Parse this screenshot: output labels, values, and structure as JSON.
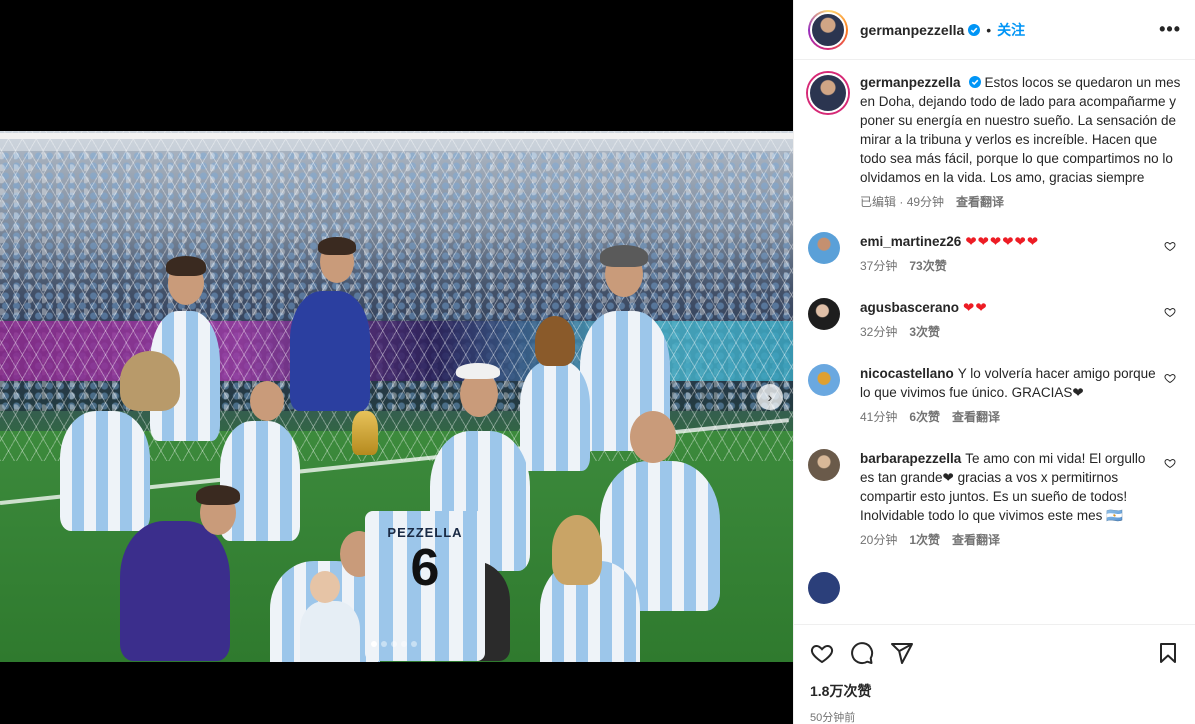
{
  "post": {
    "username": "germanpezzella",
    "separator": "•",
    "follow_label": "关注",
    "more_label": "•••"
  },
  "photo": {
    "jersey_name": "PEZZELLA",
    "jersey_number": "6",
    "slide_count": 5,
    "active_slide": 1
  },
  "caption": {
    "username": "germanpezzella",
    "text": "Estos locos se quedaron un mes en Doha, dejando todo de lado para acompañarme y poner su energía en nuestro sueño. La sensación de mirar a la tribuna y verlos es increíble. Hacen que todo sea más fácil, porque lo que compartimos no lo olvidamos en la vida. Los amo, gracias siempre",
    "edited": "已编辑",
    "time": "49分钟",
    "translate": "查看翻译"
  },
  "comments": [
    {
      "username": "emi_martinez26",
      "text": "❤❤❤❤❤❤",
      "time": "37分钟",
      "likes": "73次赞",
      "translate": ""
    },
    {
      "username": "agusbascerano",
      "text": "❤❤",
      "time": "32分钟",
      "likes": "3次赞",
      "translate": ""
    },
    {
      "username": "nicocastellano",
      "text": "Y lo volvería hacer amigo porque lo que vivimos fue único. GRACIAS❤",
      "time": "41分钟",
      "likes": "6次赞",
      "translate": "查看翻译"
    },
    {
      "username": "barbarapezzella",
      "text": "Te amo con mi vida! El orgullo es tan grande❤ gracias a vos x permitirnos compartir esto juntos. Es un sueño de todos! Inolvidable todo lo que vivimos este mes 🇦🇷",
      "time": "20分钟",
      "likes": "1次赞",
      "translate": "查看翻译"
    }
  ],
  "footer": {
    "likes": "1.8万次赞",
    "time": "50分钟前"
  },
  "colors": {
    "accent": "#0095f6",
    "heart": "#ed1c24",
    "muted": "#737373"
  }
}
